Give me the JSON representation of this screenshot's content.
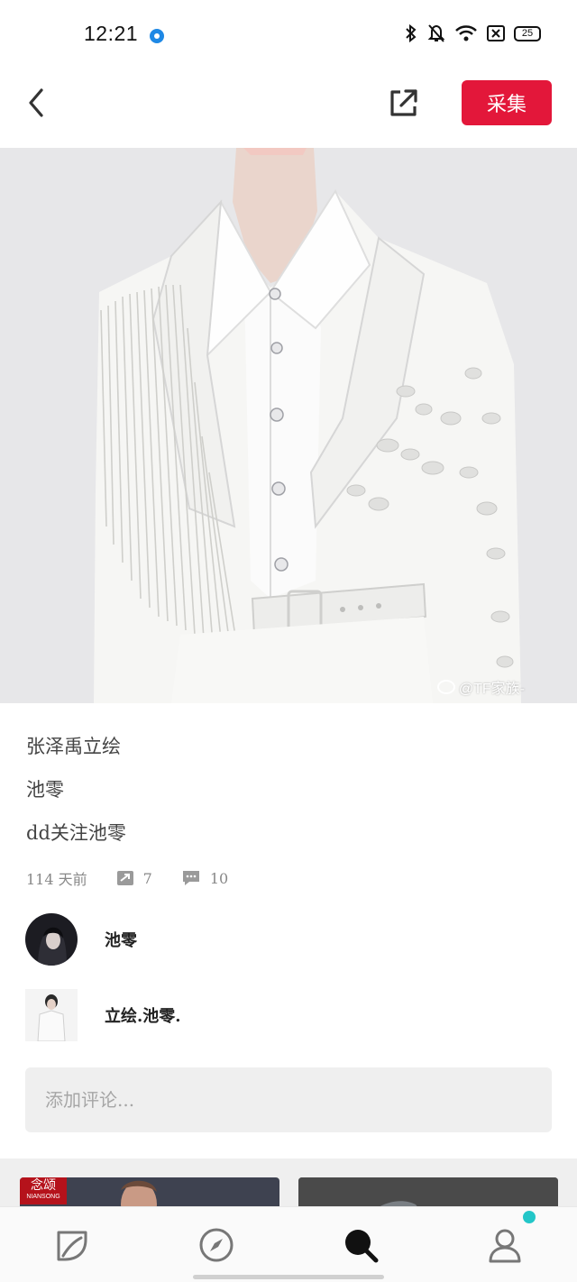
{
  "status_bar": {
    "time": "12:21",
    "battery": "25",
    "icons": [
      "bluetooth-icon",
      "bell-off-icon",
      "wifi-icon",
      "sim-icon",
      "battery-icon"
    ]
  },
  "nav": {
    "collect_label": "采集",
    "back_icon": "chevron-left-icon",
    "share_icon": "share-external-icon"
  },
  "hero": {
    "watermark": "@TF家族-"
  },
  "pin": {
    "lines": [
      "张泽禹立绘",
      "池零",
      "dd关注池零"
    ],
    "time_ago": "114 天前",
    "repins": "7",
    "comments": "10"
  },
  "users": [
    {
      "name": "池零"
    },
    {
      "name": "立绘.池零."
    }
  ],
  "comment": {
    "placeholder": "添加评论..."
  },
  "feed": {
    "left_tag": "念颂",
    "left_tag_sub": "NIANSONG"
  },
  "tabbar": {
    "items": [
      "home-leaf-icon",
      "compass-icon",
      "search-icon",
      "profile-icon"
    ],
    "accent": "#23c6c8",
    "brand": "#e3173a"
  }
}
